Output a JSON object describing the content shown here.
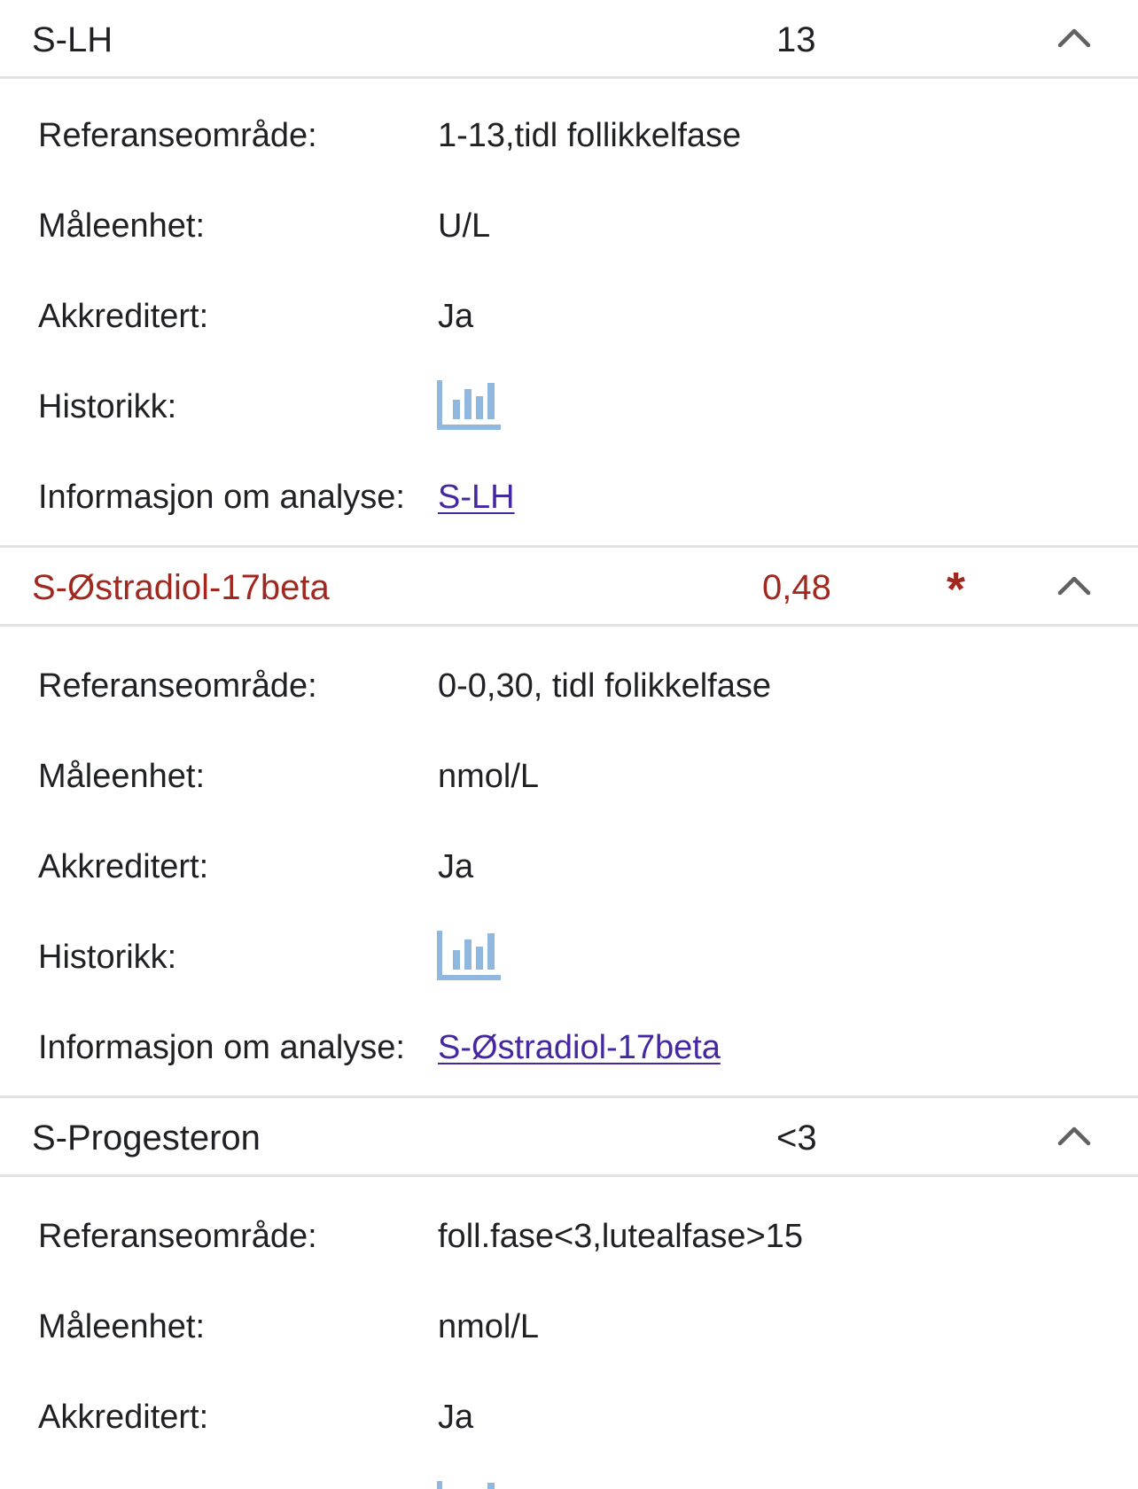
{
  "results": [
    {
      "name": "S-LH",
      "value": "13",
      "flag": "",
      "details": {
        "reference_label": "Referanseområde:",
        "reference_value": "1-13,tidl follikkelfase",
        "unit_label": "Måleenhet:",
        "unit_value": "U/L",
        "accredited_label": "Akkreditert:",
        "accredited_value": "Ja",
        "history_label": "Historikk:",
        "history_icon": "bar-chart-icon",
        "info_label": "Informasjon om analyse:",
        "info_link": "S-LH"
      }
    },
    {
      "name": "S-Østradiol-17beta",
      "value": "0,48",
      "flag": "*",
      "details": {
        "reference_label": "Referanseområde:",
        "reference_value": "0-0,30, tidl folikkelfase",
        "unit_label": "Måleenhet:",
        "unit_value": "nmol/L",
        "accredited_label": "Akkreditert:",
        "accredited_value": "Ja",
        "history_label": "Historikk:",
        "history_icon": "bar-chart-icon",
        "info_label": "Informasjon om analyse:",
        "info_link": "S-Østradiol-17beta"
      }
    },
    {
      "name": "S-Progesteron",
      "value": "<3",
      "flag": "",
      "details": {
        "reference_label": "Referanseområde:",
        "reference_value": "foll.fase<3,lutealfase>15",
        "unit_label": "Måleenhet:",
        "unit_value": "nmol/L",
        "accredited_label": "Akkreditert:",
        "accredited_value": "Ja",
        "history_icon": "bar-chart-icon"
      }
    }
  ],
  "colors": {
    "flagged_text": "#a1281f",
    "link": "#4527a0",
    "history_icon": "#90b8de",
    "separator": "#e2e2e2",
    "chevron": "#616161"
  },
  "icons": {
    "expand_toggle": "chevron-up-icon",
    "history": "bar-chart-icon"
  }
}
